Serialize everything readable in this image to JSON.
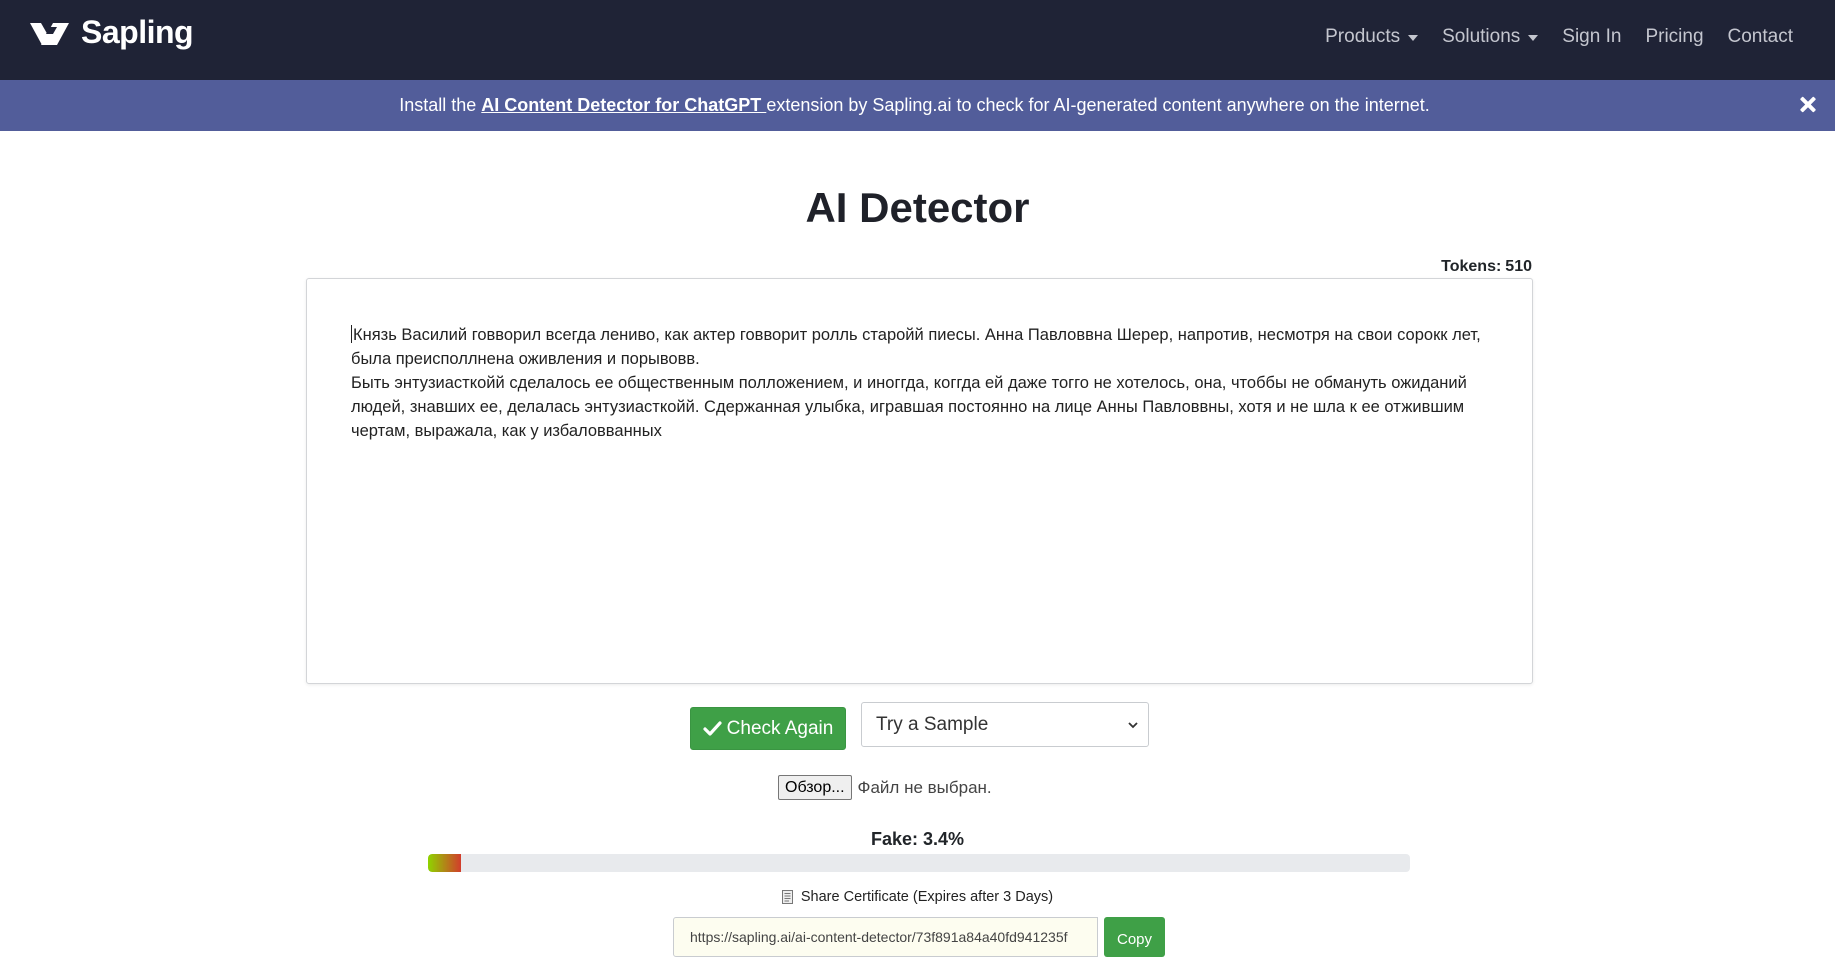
{
  "nav": {
    "brand": "Sapling",
    "links": [
      {
        "label": "Products",
        "dropdown": true
      },
      {
        "label": "Solutions",
        "dropdown": true
      },
      {
        "label": "Sign In",
        "dropdown": false
      },
      {
        "label": "Pricing",
        "dropdown": false
      },
      {
        "label": "Contact",
        "dropdown": false
      }
    ]
  },
  "banner": {
    "prefix": "Install the ",
    "link_text": "AI Content Detector for ChatGPT ",
    "suffix": " extension by Sapling.ai to check for AI-generated content anywhere on the internet."
  },
  "page": {
    "title": "AI Detector",
    "tokens_label": "Tokens:",
    "tokens_value": "510"
  },
  "editor": {
    "paragraphs": [
      "Князь Василий говворил всегда лениво, как актер говворит ролль старойй пиесы. Анна Павловвна Шерер, напротив, несмотря на свои сорокк лет, была преисполлнена оживления и порывовв.",
      "Быть энтузиасткойй сделалось ее общественным полложением, и иноггда, коггда ей даже тогго не хотелось, она, чтоббы не обмануть ожиданий людей, знавших ее, делалась энтузиасткойй. Сдержанная улыбка, игравшая постоянно на лице Анны Павловвны, хотя и не шла к ее отжившим чертам, выражала, как у избаловванных"
    ]
  },
  "controls": {
    "check_button": "Check Again",
    "sample_select": "Try a Sample",
    "file_button": "Обзор...",
    "file_status": "Файл не выбран."
  },
  "result": {
    "fake_label": "Fake: 3.4%",
    "fake_fraction": 0.034
  },
  "share": {
    "label": "Share Certificate (Expires after 3 Days)",
    "url": "https://sapling.ai/ai-content-detector/73f891a84a40fd941235f",
    "copy_button": "Copy"
  },
  "colors": {
    "navbar": "#1f2336",
    "banner": "#525d9a",
    "accent_green": "#3fa047"
  },
  "icons": {
    "brand_logo": "sapling-logo-icon",
    "close": "close-icon",
    "check": "check-icon",
    "select": "chevron-down-icon",
    "share": "document-icon"
  }
}
